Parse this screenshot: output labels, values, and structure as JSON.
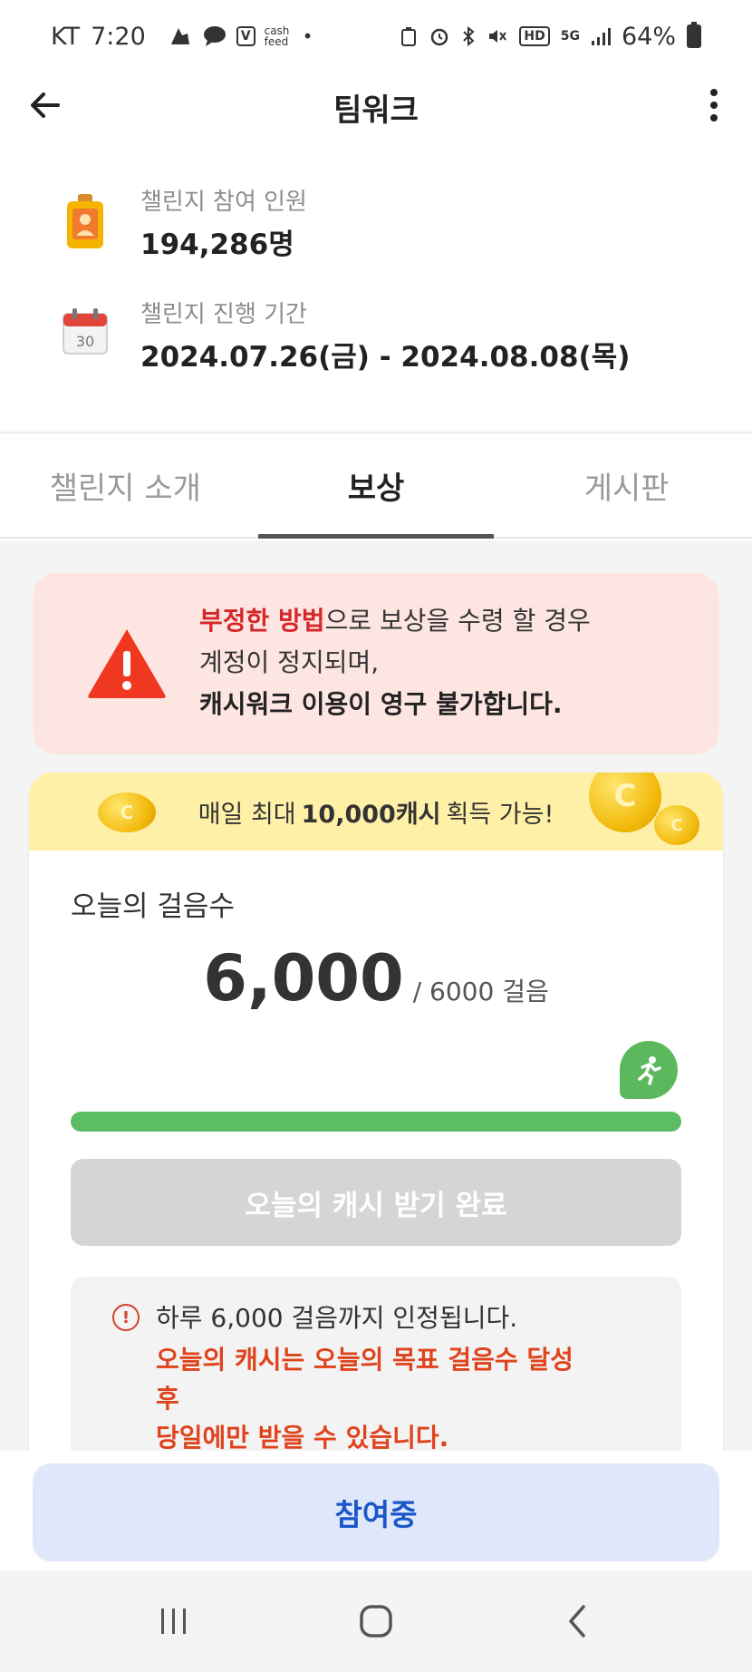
{
  "status_bar": {
    "carrier": "KT",
    "time": "7:20",
    "cash_feed_label": "cash feed",
    "hd_label": "HD",
    "network_label": "5G",
    "battery": "64%"
  },
  "app_bar": {
    "title": "팀워크"
  },
  "info": {
    "participants_label": "챌린지 참여 인원",
    "participants_value": "194,286명",
    "period_label": "챌린지 진행 기간",
    "period_value": "2024.07.26(금) - 2024.08.08(목)",
    "calendar_day": "30"
  },
  "tabs": [
    {
      "label": "챌린지 소개",
      "active": false
    },
    {
      "label": "보상",
      "active": true
    },
    {
      "label": "게시판",
      "active": false
    }
  ],
  "warning": {
    "highlight": "부정한 방법",
    "line1_rest": "으로 보상을 수령 할 경우",
    "line2": "계정이 정지되며,",
    "line3": "캐시워크 이용이 영구 불가합니다."
  },
  "reward_card": {
    "banner_prefix": "매일 최대",
    "banner_bold": "10,000캐시",
    "banner_suffix": "획득 가능!",
    "steps_title": "오늘의 걸음수",
    "steps_value": "6,000",
    "steps_goal": "/ 6000 걸음",
    "progress_fraction": 1.0,
    "claim_button": "오늘의 캐시 받기 완료",
    "notice_line1": "하루 6,000 걸음까지 인정됩니다.",
    "notice_red_line1": "오늘의 캐시는 오늘의 목표 걸음수 달성",
    "notice_red_line2": "후",
    "notice_red_line3": "당일에만 받을 수 있습니다."
  },
  "join_button": "참여중",
  "colors": {
    "accent_blue": "#1b56c9",
    "warning_red": "#d6262a",
    "progress_green": "#5cbd62",
    "banner_yellow": "#fff0a8"
  },
  "icons": [
    "back-arrow-icon",
    "more-vert-icon",
    "badge-icon",
    "calendar-icon",
    "warning-triangle-icon",
    "coin-icon",
    "runner-icon",
    "info-circle-icon",
    "recent-apps-icon",
    "home-icon",
    "nav-back-icon"
  ]
}
